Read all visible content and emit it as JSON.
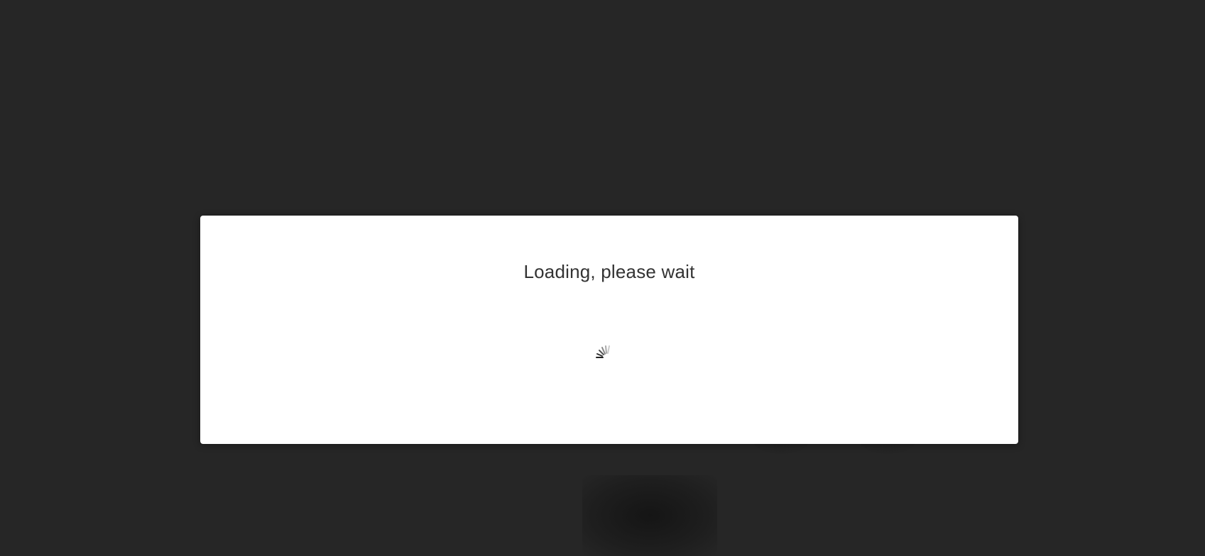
{
  "dialog": {
    "message": "Loading, please wait",
    "spinner_icon": "loading-spinner-icon"
  },
  "colors": {
    "overlay": "#262626",
    "dialog_bg": "#ffffff",
    "text": "#333333"
  }
}
